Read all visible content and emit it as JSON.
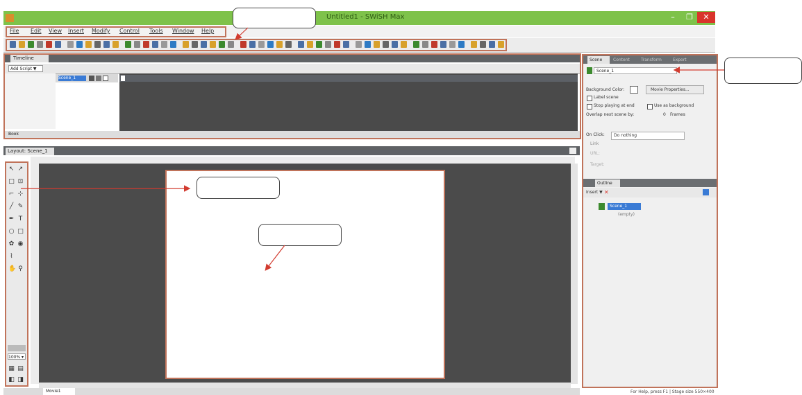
{
  "window": {
    "title": "Untitled1 - SWiSH Max",
    "buttons": [
      "–",
      "❐",
      "✕"
    ]
  },
  "menu": [
    "File",
    "Edit",
    "View",
    "Insert",
    "Modify",
    "Control",
    "Tools",
    "Window",
    "Help"
  ],
  "timeline": {
    "tab": "Timeline",
    "add_script": "Add Script ▼",
    "layer": "Scene_1",
    "bottom_label": "Book"
  },
  "document": {
    "tab": "Layout: Scene_1",
    "zoom": "100% ▾",
    "bottom_tab": "Movie1"
  },
  "properties": {
    "tabs": [
      "Scene",
      "Content",
      "Transform",
      "Export"
    ],
    "scene_name": "Scene_1",
    "background_label": "Background Color:",
    "move_button": "Movie Properties...",
    "label_scene": "Label scene",
    "stop_playing": "Stop playing at end",
    "use_as_background": "Use as background",
    "overlap_label": "Overlap next scene by:",
    "overlap_value": "0",
    "frames": "Frames",
    "onclick_label": "On Click:",
    "onclick_value": "Do nothing",
    "link": "Link",
    "url": "URL:",
    "target": "Target:"
  },
  "outline": {
    "tab": "Outline",
    "insert": "Insert ▼",
    "scene": "Scene_1",
    "empty": "(empty)"
  },
  "status": "For Help, press F1  |  Stage size 550×400"
}
